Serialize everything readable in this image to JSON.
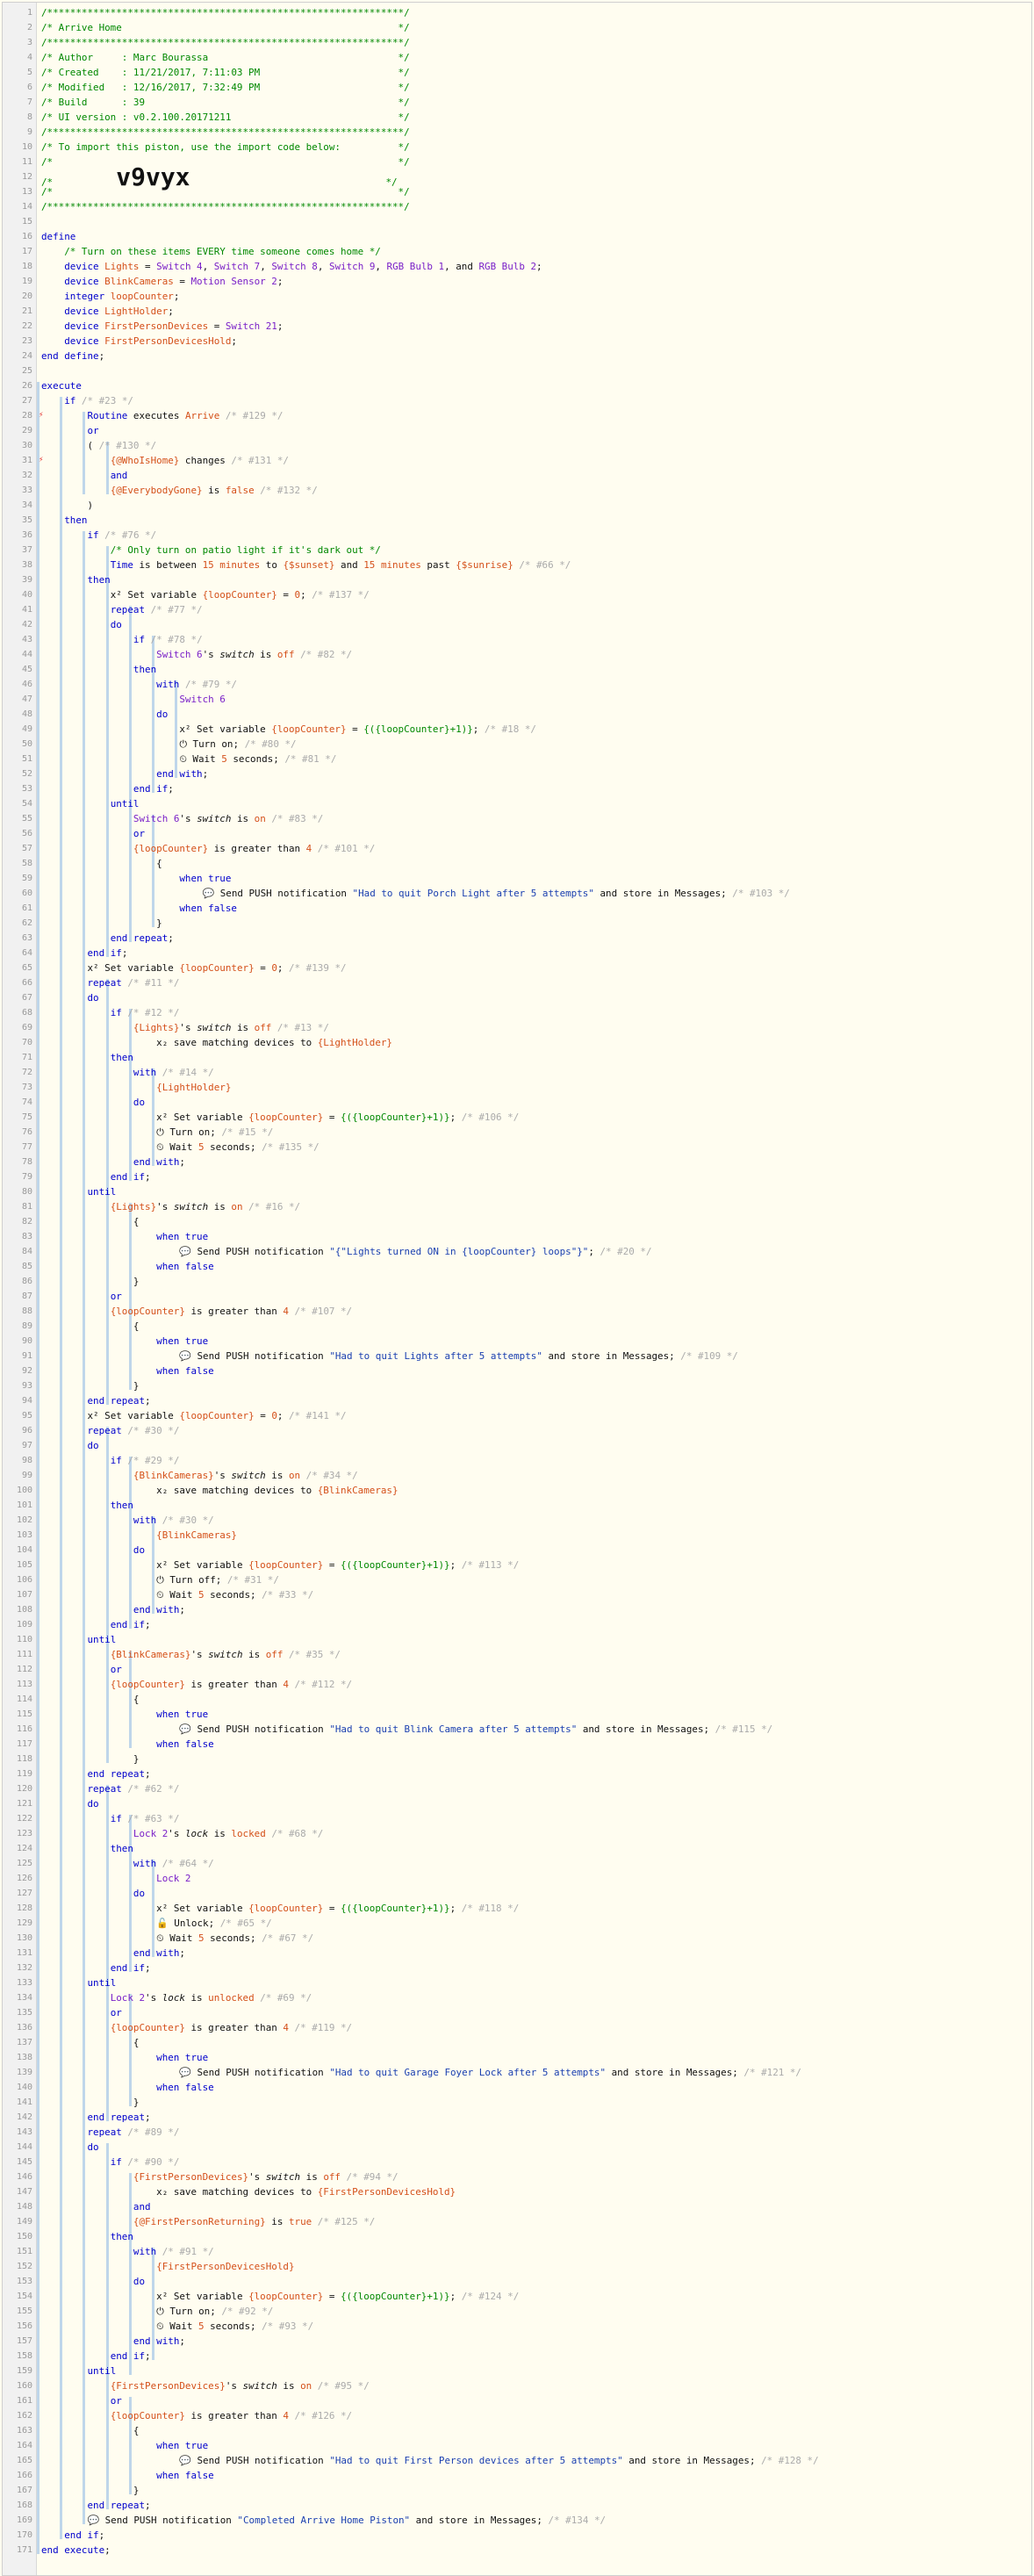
{
  "editor": {
    "title": "Arrive Home"
  },
  "lines": [
    "<span class='c'>/**************************************************************/</span>",
    "<span class='c'>/* Arrive Home                                                */</span>",
    "<span class='c'>/**************************************************************/</span>",
    "<span class='c'>/* Author     : Marc Bourassa                                 */</span>",
    "<span class='c'>/* Created    : 11/21/2017, 7:11:03 PM                        */</span>",
    "<span class='c'>/* Modified   : 12/16/2017, 7:32:49 PM                        */</span>",
    "<span class='c'>/* Build      : 39                                            */</span>",
    "<span class='c'>/* UI version : v0.2.100.20171211                             */</span>",
    "<span class='c'>/**************************************************************/</span>",
    "<span class='c'>/* To import this piston, use the import code below:          */</span>",
    "<span class='c'>/*                                                            */</span>",
    "<span class='c'>/*           </span><span class='big'>v9vyx</span><span class='c'>                                  */</span>",
    "<span class='c'>/*                                                            */</span>",
    "<span class='c'>/**************************************************************/</span>",
    "",
    "<span class='k'>define</span>",
    "    <span class='c'>/* Turn on these items EVERY time someone comes home */</span>",
    "    <span class='k'>device</span> <span class='v'>Lights</span> = <span class='dn'>Switch 4</span>, <span class='dn'>Switch 7</span>, <span class='dn'>Switch 8</span>, <span class='dn'>Switch 9</span>, <span class='dn'>RGB Bulb 1</span>, and <span class='dn'>RGB Bulb 2</span>;",
    "    <span class='k'>device</span> <span class='v'>BlinkCameras</span> = <span class='dn'>Motion Sensor 2</span>;",
    "    <span class='k'>integer</span> <span class='v'>loopCounter</span>;",
    "    <span class='k'>device</span> <span class='v'>LightHolder</span>;",
    "    <span class='k'>device</span> <span class='v'>FirstPersonDevices</span> = <span class='dn'>Switch 21</span>;",
    "    <span class='k'>device</span> <span class='v'>FirstPersonDevicesHold</span>;",
    "<span class='k'>end define</span>;",
    "",
    "<span class='k'>execute</span>",
    "    <span class='k'>if</span> <span class='g'>/* #23 */</span>",
    "        <span class='k'>Routine</span> executes <span class='v'>Arrive</span> <span class='g'>/* #129 */</span>",
    "        <span class='k'>or</span>",
    "        ( <span class='g'>/* #130 */</span>",
    "            <span class='v'>{@WhoIsHome}</span> changes <span class='g'>/* #131 */</span>",
    "            <span class='k'>and</span>",
    "            <span class='v'>{@EverybodyGone}</span> is <span class='n'>false</span> <span class='g'>/* #132 */</span>",
    "        )",
    "    <span class='k'>then</span>",
    "        <span class='k'>if</span> <span class='g'>/* #76 */</span>",
    "            <span class='c'>/* Only turn on patio light if it's dark out */</span>",
    "            <span class='k'>Time</span> is between <span class='n'>15</span> <span class='n'>minutes</span> to <span class='v'>{$sunset}</span> and <span class='n'>15</span> <span class='n'>minutes</span> past <span class='v'>{$sunrise}</span> <span class='g'>/* #66 */</span>",
    "        <span class='k'>then</span>",
    "            <span class='ic'>x²</span> Set variable <span class='v'>{loopCounter}</span> = <span class='n'>0</span>; <span class='g'>/* #137 */</span>",
    "            <span class='k'>repeat</span> <span class='g'>/* #77 */</span>",
    "            <span class='k'>do</span>",
    "                <span class='k'>if</span> <span class='g'>/* #78 */</span>",
    "                    <span class='dn'>Switch 6</span>'s <span class='i'>switch</span> is <span class='n'>off</span> <span class='g'>/* #82 */</span>",
    "                <span class='k'>then</span>",
    "                    <span class='k'>with</span> <span class='g'>/* #79 */</span>",
    "                        <span class='dn'>Switch 6</span>",
    "                    <span class='k'>do</span>",
    "                        <span class='ic'>x²</span> Set variable <span class='v'>{loopCounter}</span> = <span class='e'>{({loopCounter}+1)}</span>; <span class='g'>/* #18 */</span>",
    "                        <span class='ic'>⏻</span> Turn on; <span class='g'>/* #80 */</span>",
    "                        <span class='ic'>⏲</span> Wait <span class='n'>5</span> seconds; <span class='g'>/* #81 */</span>",
    "                    <span class='k'>end with</span>;",
    "                <span class='k'>end if</span>;",
    "            <span class='k'>until</span>",
    "                <span class='dn'>Switch 6</span>'s <span class='i'>switch</span> is <span class='n'>on</span> <span class='g'>/* #83 */</span>",
    "                <span class='k'>or</span>",
    "                <span class='v'>{loopCounter}</span> is greater than <span class='n'>4</span> <span class='g'>/* #101 */</span>",
    "                    {",
    "                        <span class='k'>when true</span>",
    "                            <span class='ic'>💬</span> Send PUSH notification <span class='s'>\"Had to quit Porch Light after 5 attempts\"</span> and store in Messages; <span class='g'>/* #103 */</span>",
    "                        <span class='k'>when false</span>",
    "                    }",
    "            <span class='k'>end repeat</span>;",
    "        <span class='k'>end if</span>;",
    "        <span class='ic'>x²</span> Set variable <span class='v'>{loopCounter}</span> = <span class='n'>0</span>; <span class='g'>/* #139 */</span>",
    "        <span class='k'>repeat</span> <span class='g'>/* #11 */</span>",
    "        <span class='k'>do</span>",
    "            <span class='k'>if</span> <span class='g'>/* #12 */</span>",
    "                <span class='v'>{Lights}</span>'s <span class='i'>switch</span> is <span class='n'>off</span> <span class='g'>/* #13 */</span>",
    "                    <span class='ic'>x₂</span> save matching devices to <span class='v'>{LightHolder}</span>",
    "            <span class='k'>then</span>",
    "                <span class='k'>with</span> <span class='g'>/* #14 */</span>",
    "                    <span class='v'>{LightHolder}</span>",
    "                <span class='k'>do</span>",
    "                    <span class='ic'>x²</span> Set variable <span class='v'>{loopCounter}</span> = <span class='e'>{({loopCounter}+1)}</span>; <span class='g'>/* #106 */</span>",
    "                    <span class='ic'>⏻</span> Turn on; <span class='g'>/* #15 */</span>",
    "                    <span class='ic'>⏲</span> Wait <span class='n'>5</span> seconds; <span class='g'>/* #135 */</span>",
    "                <span class='k'>end with</span>;",
    "            <span class='k'>end if</span>;",
    "        <span class='k'>until</span>",
    "            <span class='v'>{Lights}</span>'s <span class='i'>switch</span> is <span class='n'>on</span> <span class='g'>/* #16 */</span>",
    "                {",
    "                    <span class='k'>when true</span>",
    "                        <span class='ic'>💬</span> Send PUSH notification <span class='s'>\"{\"Lights turned ON in {loopCounter} loops\"}\"</span>; <span class='g'>/* #20 */</span>",
    "                    <span class='k'>when false</span>",
    "                }",
    "            <span class='k'>or</span>",
    "            <span class='v'>{loopCounter}</span> is greater than <span class='n'>4</span> <span class='g'>/* #107 */</span>",
    "                {",
    "                    <span class='k'>when true</span>",
    "                        <span class='ic'>💬</span> Send PUSH notification <span class='s'>\"Had to quit Lights after 5 attempts\"</span> and store in Messages; <span class='g'>/* #109 */</span>",
    "                    <span class='k'>when false</span>",
    "                }",
    "        <span class='k'>end repeat</span>;",
    "        <span class='ic'>x²</span> Set variable <span class='v'>{loopCounter}</span> = <span class='n'>0</span>; <span class='g'>/* #141 */</span>",
    "        <span class='k'>repeat</span> <span class='g'>/* #30 */</span>",
    "        <span class='k'>do</span>",
    "            <span class='k'>if</span> <span class='g'>/* #29 */</span>",
    "                <span class='v'>{BlinkCameras}</span>'s <span class='i'>switch</span> is <span class='n'>on</span> <span class='g'>/* #34 */</span>",
    "                    <span class='ic'>x₂</span> save matching devices to <span class='v'>{BlinkCameras}</span>",
    "            <span class='k'>then</span>",
    "                <span class='k'>with</span> <span class='g'>/* #30 */</span>",
    "                    <span class='v'>{BlinkCameras}</span>",
    "                <span class='k'>do</span>",
    "                    <span class='ic'>x²</span> Set variable <span class='v'>{loopCounter}</span> = <span class='e'>{({loopCounter}+1)}</span>; <span class='g'>/* #113 */</span>",
    "                    <span class='ic'>⏻</span> Turn off; <span class='g'>/* #31 */</span>",
    "                    <span class='ic'>⏲</span> Wait <span class='n'>5</span> seconds; <span class='g'>/* #33 */</span>",
    "                <span class='k'>end with</span>;",
    "            <span class='k'>end if</span>;",
    "        <span class='k'>until</span>",
    "            <span class='v'>{BlinkCameras}</span>'s <span class='i'>switch</span> is <span class='n'>off</span> <span class='g'>/* #35 */</span>",
    "            <span class='k'>or</span>",
    "            <span class='v'>{loopCounter}</span> is greater than <span class='n'>4</span> <span class='g'>/* #112 */</span>",
    "                {",
    "                    <span class='k'>when true</span>",
    "                        <span class='ic'>💬</span> Send PUSH notification <span class='s'>\"Had to quit Blink Camera after 5 attempts\"</span> and store in Messages; <span class='g'>/* #115 */</span>",
    "                    <span class='k'>when false</span>",
    "                }",
    "        <span class='k'>end repeat</span>;",
    "        <span class='k'>repeat</span> <span class='g'>/* #62 */</span>",
    "        <span class='k'>do</span>",
    "            <span class='k'>if</span> <span class='g'>/* #63 */</span>",
    "                <span class='dn'>Lock 2</span>'s <span class='i'>lock</span> is <span class='n'>locked</span> <span class='g'>/* #68 */</span>",
    "            <span class='k'>then</span>",
    "                <span class='k'>with</span> <span class='g'>/* #64 */</span>",
    "                    <span class='dn'>Lock 2</span>",
    "                <span class='k'>do</span>",
    "                    <span class='ic'>x²</span> Set variable <span class='v'>{loopCounter}</span> = <span class='e'>{({loopCounter}+1)}</span>; <span class='g'>/* #118 */</span>",
    "                    <span class='ic'>🔓</span> Unlock; <span class='g'>/* #65 */</span>",
    "                    <span class='ic'>⏲</span> Wait <span class='n'>5</span> seconds; <span class='g'>/* #67 */</span>",
    "                <span class='k'>end with</span>;",
    "            <span class='k'>end if</span>;",
    "        <span class='k'>until</span>",
    "            <span class='dn'>Lock 2</span>'s <span class='i'>lock</span> is <span class='n'>unlocked</span> <span class='g'>/* #69 */</span>",
    "            <span class='k'>or</span>",
    "            <span class='v'>{loopCounter}</span> is greater than <span class='n'>4</span> <span class='g'>/* #119 */</span>",
    "                {",
    "                    <span class='k'>when true</span>",
    "                        <span class='ic'>💬</span> Send PUSH notification <span class='s'>\"Had to quit Garage Foyer Lock after 5 attempts\"</span> and store in Messages; <span class='g'>/* #121 */</span>",
    "                    <span class='k'>when false</span>",
    "                }",
    "        <span class='k'>end repeat</span>;",
    "        <span class='k'>repeat</span> <span class='g'>/* #89 */</span>",
    "        <span class='k'>do</span>",
    "            <span class='k'>if</span> <span class='g'>/* #90 */</span>",
    "                <span class='v'>{FirstPersonDevices}</span>'s <span class='i'>switch</span> is <span class='n'>off</span> <span class='g'>/* #94 */</span>",
    "                    <span class='ic'>x₂</span> save matching devices to <span class='v'>{FirstPersonDevicesHold}</span>",
    "                <span class='k'>and</span>",
    "                <span class='v'>{@FirstPersonReturning}</span> is <span class='n'>true</span> <span class='g'>/* #125 */</span>",
    "            <span class='k'>then</span>",
    "                <span class='k'>with</span> <span class='g'>/* #91 */</span>",
    "                    <span class='v'>{FirstPersonDevicesHold}</span>",
    "                <span class='k'>do</span>",
    "                    <span class='ic'>x²</span> Set variable <span class='v'>{loopCounter}</span> = <span class='e'>{({loopCounter}+1)}</span>; <span class='g'>/* #124 */</span>",
    "                    <span class='ic'>⏻</span> Turn on; <span class='g'>/* #92 */</span>",
    "                    <span class='ic'>⏲</span> Wait <span class='n'>5</span> seconds; <span class='g'>/* #93 */</span>",
    "                <span class='k'>end with</span>;",
    "            <span class='k'>end if</span>;",
    "        <span class='k'>until</span>",
    "            <span class='v'>{FirstPersonDevices}</span>'s <span class='i'>switch</span> is <span class='n'>on</span> <span class='g'>/* #95 */</span>",
    "            <span class='k'>or</span>",
    "            <span class='v'>{loopCounter}</span> is greater than <span class='n'>4</span> <span class='g'>/* #126 */</span>",
    "                {",
    "                    <span class='k'>when true</span>",
    "                        <span class='ic'>💬</span> Send PUSH notification <span class='s'>\"Had to quit First Person devices after 5 attempts\"</span> and store in Messages; <span class='g'>/* #128 */</span>",
    "                    <span class='k'>when false</span>",
    "                }",
    "        <span class='k'>end repeat</span>;",
    "        <span class='ic'>💬</span> Send PUSH notification <span class='s'>\"Completed Arrive Home Piston\"</span> and store in Messages; <span class='g'>/* #134 */</span>",
    "    <span class='k'>end if</span>;",
    "<span class='k'>end execute</span>;"
  ],
  "markers": [
    28,
    31
  ]
}
